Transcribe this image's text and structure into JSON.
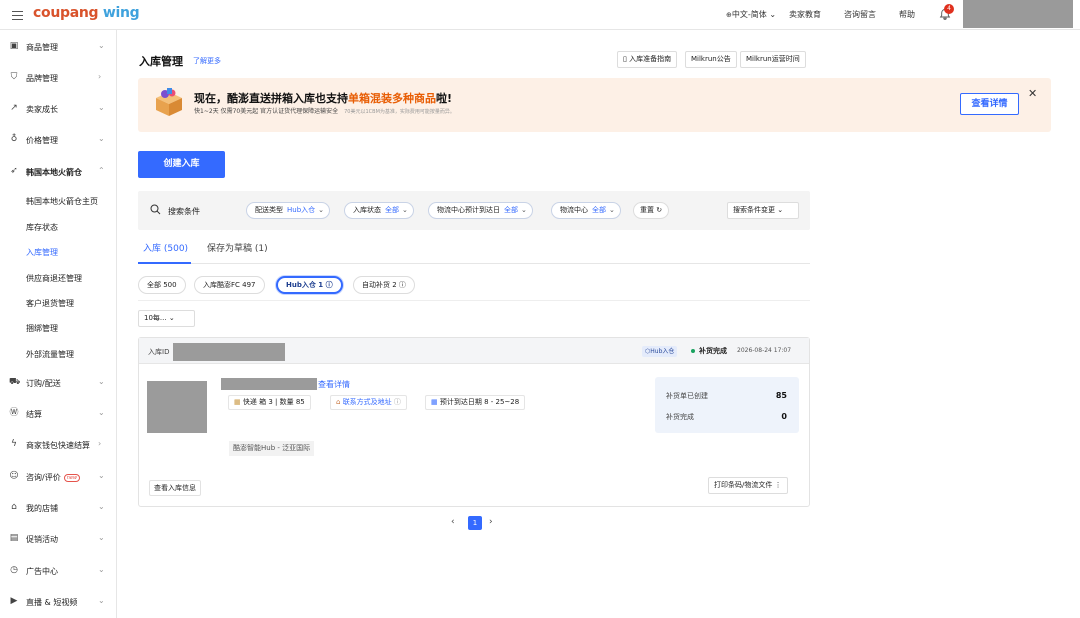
{
  "header": {
    "logo_part1": "coupang",
    "logo_part2": "wing",
    "language": "中文-简体",
    "nav": [
      "卖家教育",
      "咨询留言",
      "帮助"
    ],
    "notification_count": "4"
  },
  "sidebar": {
    "items": [
      {
        "label": "商品管理",
        "icon": "box-icon"
      },
      {
        "label": "品牌管理",
        "icon": "shield-icon"
      },
      {
        "label": "卖家成长",
        "icon": "trend-icon"
      },
      {
        "label": "价格管理",
        "icon": "price-tag-icon"
      },
      {
        "label": "韩国本地火箭仓",
        "icon": "rocket-icon"
      },
      {
        "label": "订购/配送",
        "icon": "truck-icon"
      },
      {
        "label": "结算",
        "icon": "coin-icon"
      },
      {
        "label": "商家钱包快速结算",
        "icon": "lightning-icon"
      },
      {
        "label": "咨询/评价",
        "icon": "chat-icon",
        "badge": "new"
      },
      {
        "label": "我的店铺",
        "icon": "store-icon"
      },
      {
        "label": "促销活动",
        "icon": "promo-icon"
      },
      {
        "label": "广告中心",
        "icon": "ad-icon"
      },
      {
        "label": "直播 & 短视频",
        "icon": "video-icon"
      }
    ],
    "subitems": [
      "韩国本地火箭仓主页",
      "库存状态",
      "入库管理",
      "供应商退还管理",
      "客户退货管理",
      "捆绑管理",
      "外部流量管理"
    ]
  },
  "page": {
    "title": "入库管理",
    "learn_more": "了解更多",
    "top_buttons": [
      "入库准备指南",
      "Milkrun公告",
      "Milkrun运营时间"
    ]
  },
  "banner": {
    "title_prefix": "现在，酷澎直送拼箱入库也支持",
    "title_highlight": "单箱混装多种商品",
    "title_suffix": "啦!",
    "subtitle": "快1~2天  仅需70美元起  官方认证货代理保障运输安全",
    "note": "70美元以1CBM为基准，实际费用可能按量而异。",
    "detail_button": "查看详情",
    "close": "✕"
  },
  "create_button": "创建入库",
  "filters": {
    "label": "搜索条件",
    "chips": [
      {
        "name": "配送类型",
        "value": "Hub入仓"
      },
      {
        "name": "入库状态",
        "value": "全部"
      },
      {
        "name": "物流中心预计到达日",
        "value": "全部"
      },
      {
        "name": "物流中心",
        "value": "全部"
      }
    ],
    "reset": "重置",
    "condition_change": "搜索条件变更"
  },
  "tabs": [
    {
      "label": "入库 (500)",
      "active": true
    },
    {
      "label": "保存为草稿 (1)",
      "active": false
    }
  ],
  "pills": [
    {
      "label": "全部 500"
    },
    {
      "label": "入库酷澎FC 497"
    },
    {
      "label": "Hub入仓 1 ⓘ",
      "active": true
    },
    {
      "label": "自动补货 2 ⓘ"
    }
  ],
  "per_page": "10每...",
  "card": {
    "id_label": "入库ID",
    "hub_tag": "Hub入仓",
    "status": "补货完成",
    "timestamp": "2026-08-24 17:07",
    "detail_link": "查看详情",
    "meta": {
      "express": "快递",
      "boxes": "箱 3",
      "quantity": "数量 85",
      "contact": "联系方式及地址",
      "eta": "预计到达日期 8 - 25~28"
    },
    "hub_location": "酷澎智能Hub - 泛亚国际",
    "summary": [
      {
        "label": "补货单已创建",
        "value": "85"
      },
      {
        "label": "补货完成",
        "value": "0"
      }
    ],
    "info_button": "查看入库信息",
    "print_button": "打印条码/物流文件 ⋮"
  },
  "pagination": {
    "prev": "‹",
    "current": "1",
    "next": "›"
  },
  "colors": {
    "primary": "#346aff",
    "banner_bg": "#fdf0e6",
    "highlight": "#e85d04",
    "status_green": "#1aa260"
  }
}
